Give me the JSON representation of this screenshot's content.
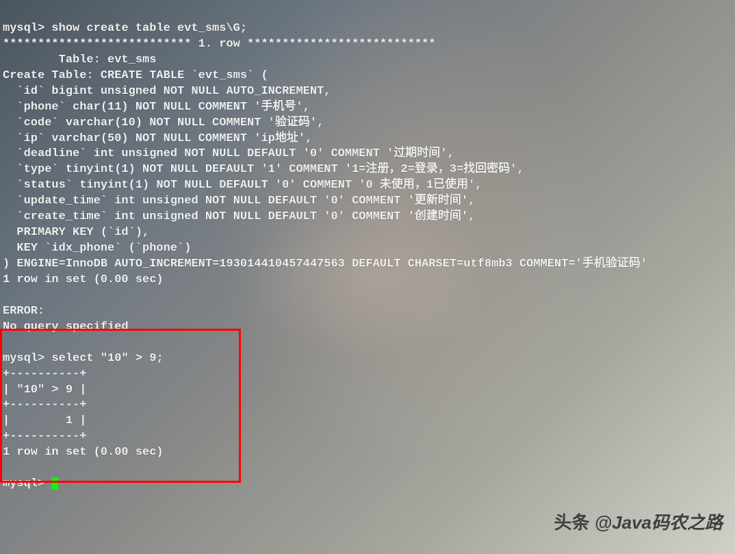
{
  "terminal": {
    "prompt": "mysql>",
    "cmd1": "show create table evt_sms\\G;",
    "row_sep": "*************************** 1. row ***************************",
    "table_label": "        Table: evt_sms",
    "create_label": "Create Table: CREATE TABLE `evt_sms` (",
    "cols": [
      "  `id` bigint unsigned NOT NULL AUTO_INCREMENT,",
      "  `phone` char(11) NOT NULL COMMENT '手机号',",
      "  `code` varchar(10) NOT NULL COMMENT '验证码',",
      "  `ip` varchar(50) NOT NULL COMMENT 'ip地址',",
      "  `deadline` int unsigned NOT NULL DEFAULT '0' COMMENT '过期时间',",
      "  `type` tinyint(1) NOT NULL DEFAULT '1' COMMENT '1=注册，2=登录，3=找回密码',",
      "  `status` tinyint(1) NOT NULL DEFAULT '0' COMMENT '0 未使用，1已使用',",
      "  `update_time` int unsigned NOT NULL DEFAULT '0' COMMENT '更新时间',",
      "  `create_time` int unsigned NOT NULL DEFAULT '0' COMMENT '创建时间',",
      "  PRIMARY KEY (`id`),",
      "  KEY `idx_phone` (`phone`)"
    ],
    "engine": ") ENGINE=InnoDB AUTO_INCREMENT=193014410457447563 DEFAULT CHARSET=utf8mb3 COMMENT='手机验证码'",
    "rows1": "1 row in set (0.00 sec)",
    "error": "ERROR:",
    "noquery": "No query specified",
    "cmd2": "select \"10\" > 9;",
    "tbl_border": "+----------+",
    "tbl_header": "| \"10\" > 9 |",
    "tbl_row": "|        1 |",
    "rows2": "1 row in set (0.00 sec)"
  },
  "watermark": {
    "prefix": "头条",
    "handle": "@Java码农之路"
  }
}
